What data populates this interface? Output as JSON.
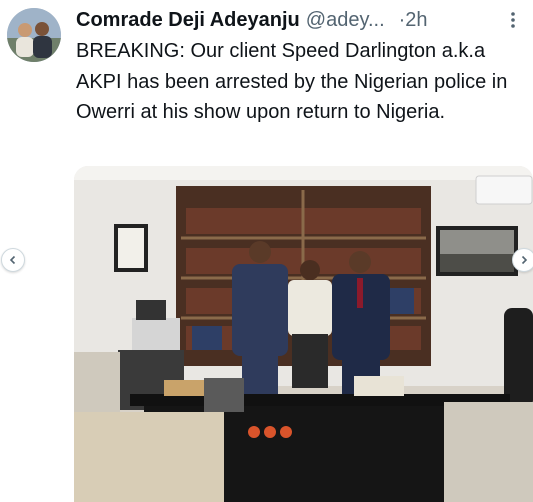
{
  "tweet": {
    "author_name": "Comrade Deji Adeyanju",
    "author_handle": "@adey...",
    "time_sep": "·",
    "time": "2h",
    "text": "BREAKING: Our client Speed Darlington a.k.a AKPI has been arrested by the Nigerian police in Owerri at his show upon return to Nigeria."
  },
  "icons": {
    "more": "more-vertical-icon",
    "prev": "chevron-left-icon",
    "next": "chevron-right-icon"
  },
  "colors": {
    "text": "#0f1419",
    "secondary": "#536471",
    "nav_border": "#cfd9de"
  }
}
